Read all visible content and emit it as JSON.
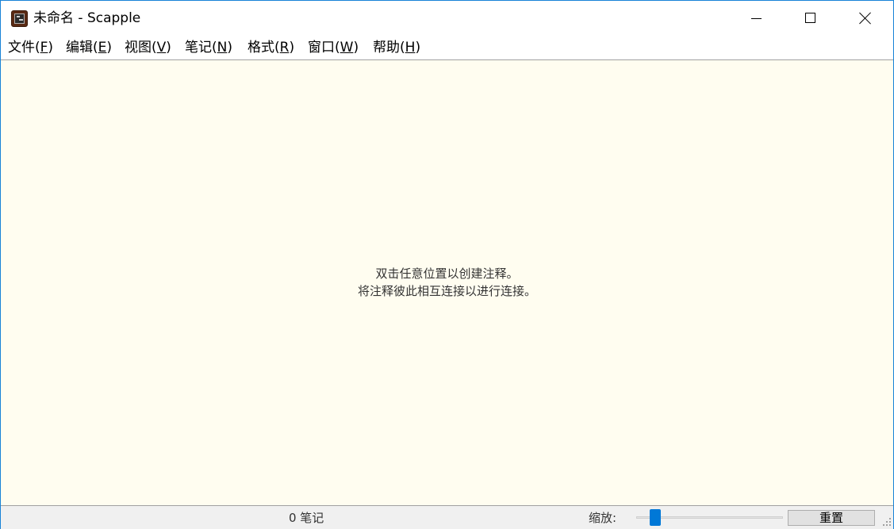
{
  "window": {
    "title": "未命名 - Scapple"
  },
  "menu": [
    {
      "label": "文件(",
      "mnemonic": "F",
      "suffix": ")"
    },
    {
      "label": "编辑(",
      "mnemonic": "E",
      "suffix": ")"
    },
    {
      "label": "视图(",
      "mnemonic": "V",
      "suffix": ")"
    },
    {
      "label": "笔记(",
      "mnemonic": "N",
      "suffix": ")"
    },
    {
      "label": "格式(",
      "mnemonic": "R",
      "suffix": ")"
    },
    {
      "label": "窗口(",
      "mnemonic": "W",
      "suffix": ")"
    },
    {
      "label": "帮助(",
      "mnemonic": "H",
      "suffix": ")"
    }
  ],
  "canvas": {
    "hint_line1": "双击任意位置以创建注释。",
    "hint_line2": "将注释彼此相互连接以进行连接。"
  },
  "status": {
    "note_count": "0 笔记",
    "zoom_label": "缩放:",
    "zoom_level": 0.1,
    "reset_label": "重置"
  },
  "colors": {
    "canvas_bg": "#fffdf0",
    "accent": "#0078d7",
    "window_border": "#1883d7"
  },
  "icons": {
    "app": "scapple-app-icon",
    "minimize": "minimize-icon",
    "maximize": "maximize-icon",
    "close": "close-icon",
    "grip": "resize-grip-icon"
  }
}
